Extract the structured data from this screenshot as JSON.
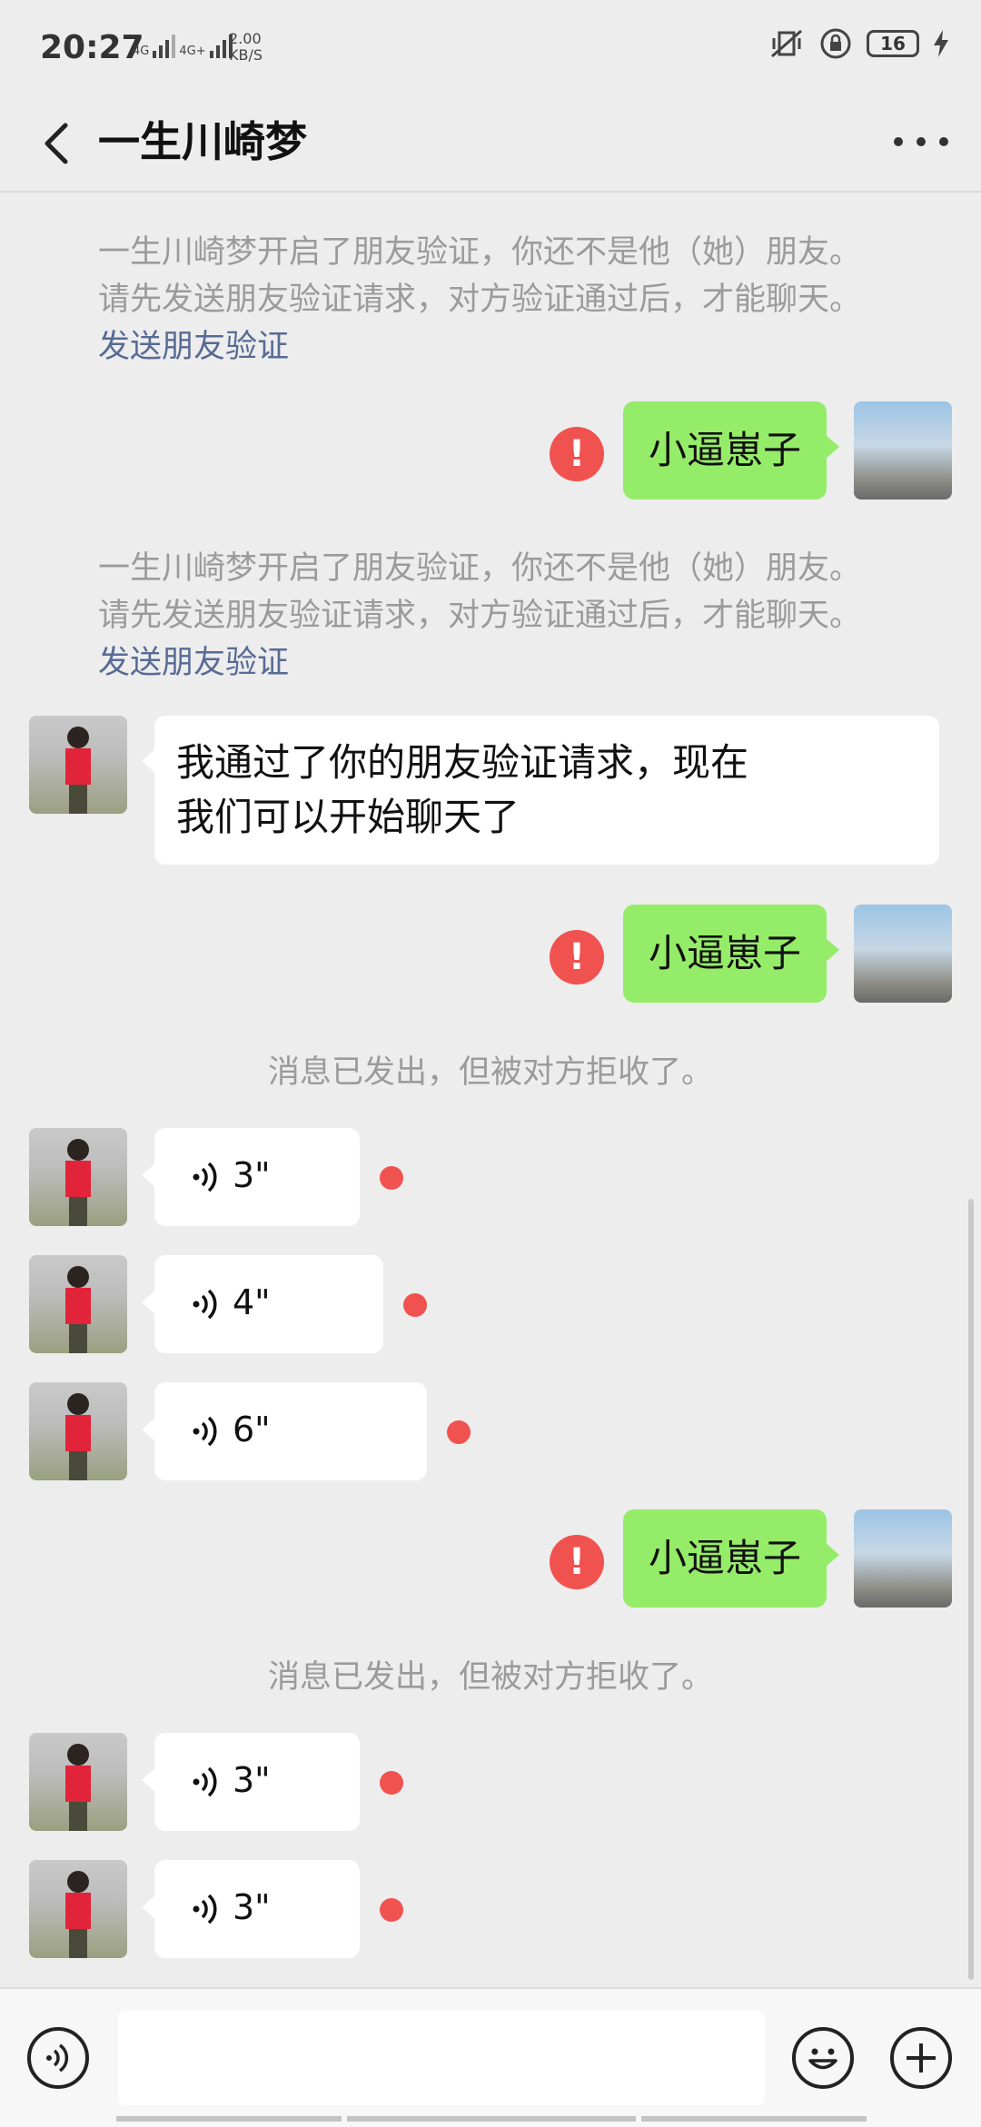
{
  "status_bar": {
    "time": "20:27",
    "net1": "4G",
    "net2": "4G+",
    "speed_value": "2.00",
    "speed_unit": "KB/S",
    "battery": "16"
  },
  "header": {
    "title": "一生川崎梦"
  },
  "system_messages": [
    {
      "line1": "一生川崎梦开启了朋友验证，你还不是他（她）朋友。",
      "line2": "请先发送朋友验证请求，对方验证通过后，才能聊天。",
      "link": "发送朋友验证"
    },
    {
      "line1": "一生川崎梦开启了朋友验证，你还不是他（她）朋友。",
      "line2": "请先发送朋友验证请求，对方验证通过后，才能聊天。",
      "link": "发送朋友验证"
    }
  ],
  "outgoing": [
    {
      "text": "小逼崽子",
      "error": "!"
    },
    {
      "text": "小逼崽子",
      "error": "!"
    },
    {
      "text": "小逼崽子",
      "error": "!"
    }
  ],
  "incoming_text": {
    "line1": "我通过了你的朋友验证请求，现在",
    "line2": "我们可以开始聊天了"
  },
  "rejected_notice": "消息已发出，但被对方拒收了。",
  "voice_messages": [
    {
      "duration": "3\""
    },
    {
      "duration": "4\""
    },
    {
      "duration": "6\""
    },
    {
      "duration": "3\""
    },
    {
      "duration": "3\""
    }
  ],
  "colors": {
    "outgoing_bubble": "#95ec69",
    "incoming_bubble": "#ffffff",
    "error_red": "#f05250",
    "link_blue": "#576b95",
    "background": "#ededed"
  }
}
